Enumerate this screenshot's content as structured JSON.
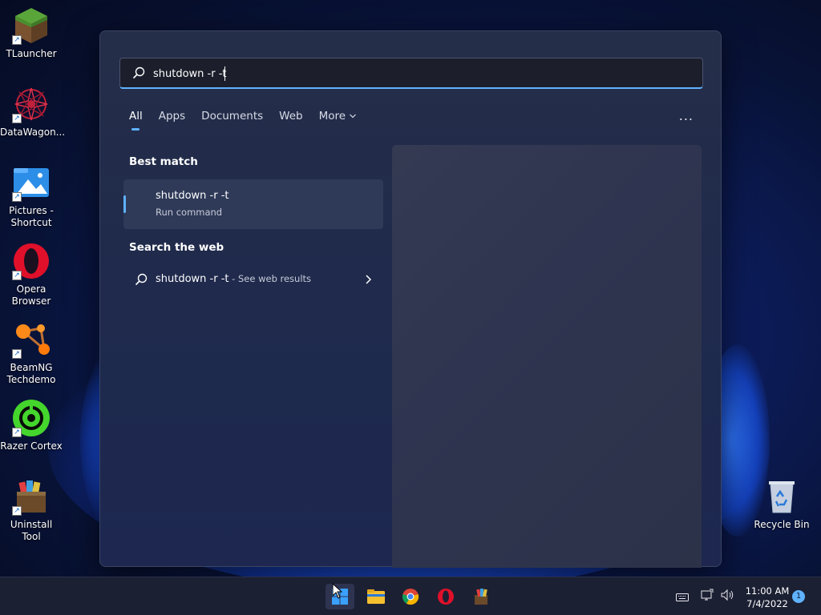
{
  "desktop": {
    "icons": [
      {
        "label_1": "TLauncher",
        "label_2": ""
      },
      {
        "label_1": "DataWagon...",
        "label_2": ""
      },
      {
        "label_1": "Pictures -",
        "label_2": "Shortcut"
      },
      {
        "label_1": "Opera",
        "label_2": "Browser"
      },
      {
        "label_1": "BeamNG",
        "label_2": "Techdemo"
      },
      {
        "label_1": "Razer Cortex",
        "label_2": ""
      },
      {
        "label_1": "Uninstall Tool",
        "label_2": ""
      }
    ],
    "recycle_bin": "Recycle Bin"
  },
  "search": {
    "query": "shutdown -r -t"
  },
  "tabs": [
    {
      "label": "All",
      "active": true
    },
    {
      "label": "Apps"
    },
    {
      "label": "Documents"
    },
    {
      "label": "Web"
    },
    {
      "label": "More"
    }
  ],
  "more_options": "...",
  "best_match": {
    "title": "Best match",
    "name": "shutdown -r -t",
    "subtitle": "Run command"
  },
  "web": {
    "title": "Search the web",
    "query": "shutdown -r -t",
    "suffix": " - See web results"
  },
  "taskbar": {
    "apps": [
      "start-icon",
      "file-explorer-icon",
      "chrome-icon",
      "opera-icon",
      "uninstall-tool-icon"
    ],
    "time": "11:00 AM",
    "date": "7/4/2022",
    "notifications": "1"
  },
  "colors": {
    "accent": "#5fb2ff",
    "panel": "#1f2a4d",
    "taskbar": "#1c2033"
  }
}
